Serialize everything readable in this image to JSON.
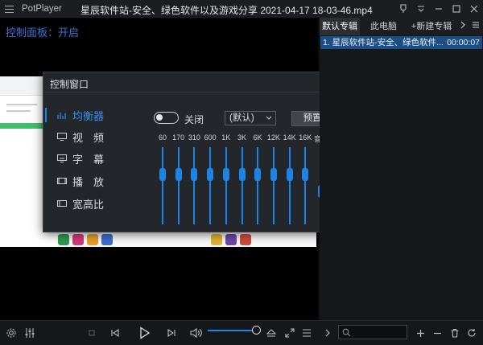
{
  "titlebar": {
    "app_name": "PotPlayer",
    "file_title": "星辰软件站-安全、绿色软件以及游戏分享 2021-04-17 18-03-46.mp4"
  },
  "osd": {
    "text": "控制面板：开启"
  },
  "control_panel": {
    "title": "控制窗口",
    "nav": [
      {
        "label": "均衡器",
        "icon": "equalizer-icon",
        "active": true
      },
      {
        "label": "视　频",
        "icon": "monitor-icon",
        "active": false
      },
      {
        "label": "字　幕",
        "icon": "subtitle-icon",
        "active": false
      },
      {
        "label": "播　放",
        "icon": "playback-icon",
        "active": false
      },
      {
        "label": "宽高比",
        "icon": "aspect-ratio-icon",
        "active": false
      }
    ],
    "toggle_label": "关闭",
    "toggle_on": false,
    "preset_value": "(默认)",
    "preset_button": "预置",
    "bands": [
      {
        "label": "60",
        "level": 0.3
      },
      {
        "label": "170",
        "level": 0.3
      },
      {
        "label": "310",
        "level": 0.3
      },
      {
        "label": "600",
        "level": 0.3
      },
      {
        "label": "1K",
        "level": 0.3
      },
      {
        "label": "3K",
        "level": 0.3
      },
      {
        "label": "6K",
        "level": 0.3
      },
      {
        "label": "12K",
        "level": 0.3
      },
      {
        "label": "14K",
        "level": 0.3
      },
      {
        "label": "16K",
        "level": 0.3
      },
      {
        "label": "音量",
        "level": -0.15
      }
    ]
  },
  "playlist": {
    "tabs": [
      "默认专辑",
      "此电脑",
      "+新建专辑"
    ],
    "items": [
      {
        "title": "1. 星辰软件站-安全、绿色软件...",
        "duration": "00:00:07"
      }
    ]
  },
  "colors": {
    "accent": "#1d84e6",
    "osd": "#3f72d6",
    "selection": "#1c4e86"
  }
}
